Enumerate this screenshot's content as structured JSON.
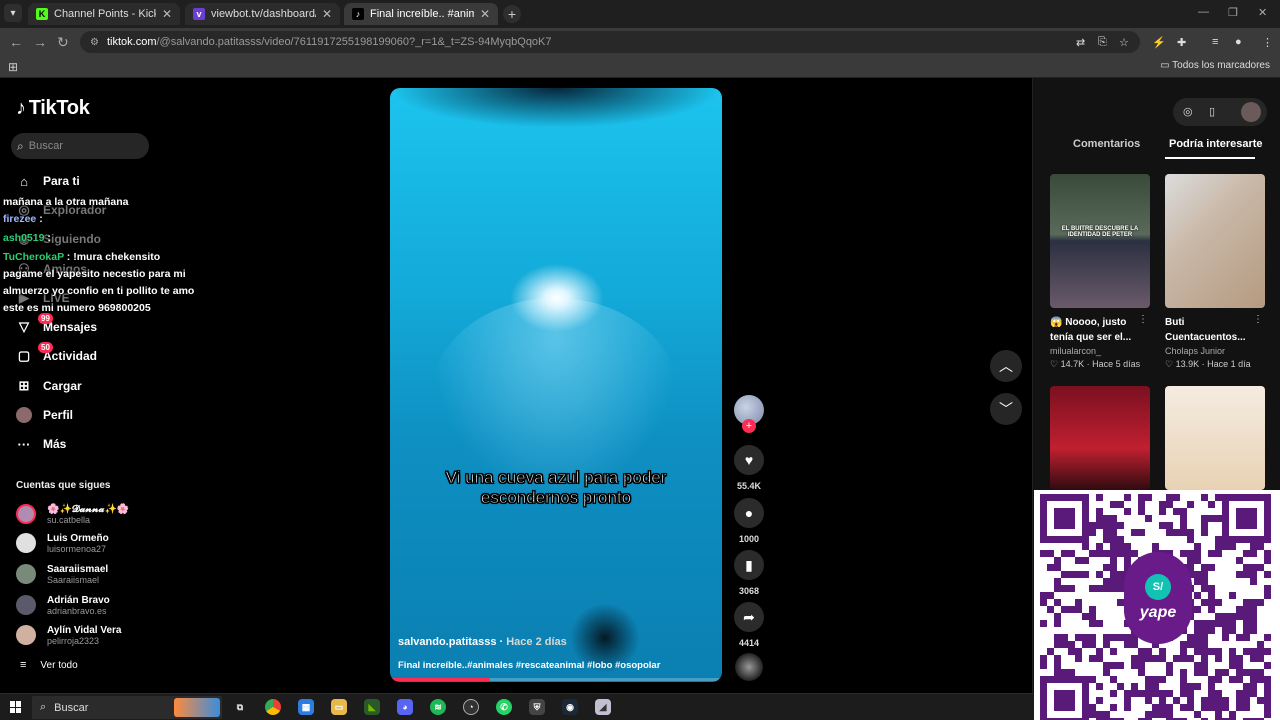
{
  "browser": {
    "tabs": [
      {
        "label": "Channel Points - Kick Dashboard",
        "favicon": "K",
        "color": "#53fc18"
      },
      {
        "label": "viewbot.tv/dashboard/kick/chil",
        "favicon": "v",
        "color": "#6b3fd4"
      },
      {
        "label": "Final increíble.. #animales #rescate",
        "favicon": "♪",
        "color": "#000000"
      }
    ],
    "url_host": "tiktok.com",
    "url_path": "/@salvando.patitasss/video/7611917255198199060?_r=1&_t=ZS-94MyqbQqoK7",
    "bookmarks_label": "Todos los marcadores"
  },
  "tiktok": {
    "logo": "TikTok",
    "search_placeholder": "Buscar",
    "nav": [
      {
        "label": "Para ti",
        "icon": "home-icon"
      },
      {
        "label": "Explorador",
        "icon": "compass-icon"
      },
      {
        "label": "Siguiendo",
        "icon": "following-icon"
      },
      {
        "label": "Amigos",
        "icon": "friends-icon"
      },
      {
        "label": "LIVE",
        "icon": "live-icon"
      },
      {
        "label": "Mensajes",
        "icon": "messages-icon",
        "badge": "99"
      },
      {
        "label": "Actividad",
        "icon": "activity-icon",
        "badge": "50"
      },
      {
        "label": "Cargar",
        "icon": "upload-icon"
      },
      {
        "label": "Perfil",
        "icon": "profile-icon"
      },
      {
        "label": "Más",
        "icon": "more-icon"
      }
    ],
    "following_title": "Cuentas que sigues",
    "accounts": [
      {
        "name": "🌸✨𝓓𝓪𝓷𝓷𝓪✨🌸",
        "handle": "su.catbella",
        "color": "#b08cb0"
      },
      {
        "name": "Luis Ormeño",
        "handle": "luisormenoa27",
        "color": "#e0e0e0"
      },
      {
        "name": "Saaraiismael",
        "handle": "Saaraiismael",
        "color": "#7a8a7a"
      },
      {
        "name": "Adrián Bravo",
        "handle": "adrianbravo.es",
        "color": "#5a5a6a"
      },
      {
        "name": "Aylín Vidal Vera",
        "handle": "pelirroja2323",
        "color": "#d0b0a0"
      }
    ],
    "see_all": "Ver todo"
  },
  "chat": [
    {
      "user": "",
      "color": "#ffffff",
      "text": "mañana a la otra mañana"
    },
    {
      "user": "firezee",
      "color": "#9fb8ff",
      "text": " :"
    },
    {
      "user": "ash0519",
      "color": "#2ecc71",
      "text": " :"
    },
    {
      "user": "TuCherokaP",
      "color": "#2ecc71",
      "text": " : !mura chekensito pagame el yapesito necestio para mi almuerzo yo confio en ti pollito te amo este es mi numero 969800205"
    }
  ],
  "video": {
    "caption": "Vi una cueva azul para poder escondernos pronto",
    "author": "salvando.patitasss",
    "time": "Hace 2 días",
    "description": "Final increíble..#animales #rescateanimal #lobo #osopolar",
    "progress": 0.3,
    "likes": "55.4K",
    "comments": "1000",
    "saves": "3068",
    "shares": "4414"
  },
  "right_panel": {
    "tabs": [
      "Comentarios",
      "Podría interesarte"
    ],
    "active_tab": "Podría interesarte",
    "cards": [
      {
        "title": "😱 Noooo, justo tenía que ser el...",
        "user": "milualarcon_",
        "likes": "♡ 14.7K",
        "time": "Hace 5 días",
        "thumb_text": "EL BUITRE DESCUBRE LA IDENTIDAD DE PETER"
      },
      {
        "title": "Buti Cuentacuentos...",
        "user": "Cholaps Junior",
        "likes": "♡ 13.9K",
        "time": "Hace 1 día",
        "thumb_text": ""
      }
    ]
  },
  "qr": {
    "brand": "yape",
    "symbol": "S/"
  },
  "taskbar": {
    "search_label": "Buscar"
  }
}
